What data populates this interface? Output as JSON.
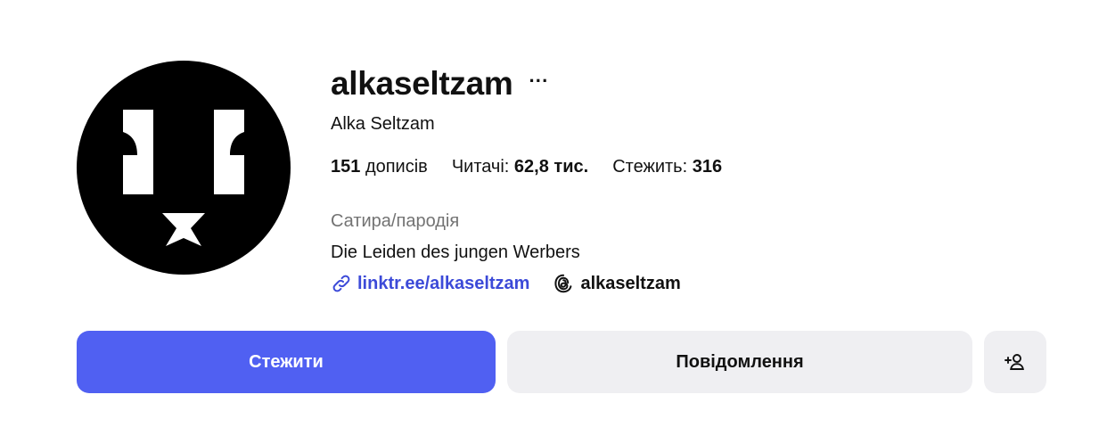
{
  "profile": {
    "username": "alkaseltzam",
    "more_label": "···",
    "full_name": "Alka Seltzam",
    "stats": {
      "posts_count": "151",
      "posts_label": "дописів",
      "followers_label": "Читачі:",
      "followers_count": "62,8 тис.",
      "following_label": "Стежить:",
      "following_count": "316"
    },
    "category": "Сатира/пародія",
    "bio": "Die Leiden des jungen Werbers",
    "link_text": "linktr.ee/alkaseltzam",
    "threads_handle": "alkaseltzam"
  },
  "actions": {
    "follow_label": "Стежити",
    "message_label": "Повідомлення",
    "add_user_icon": "person-add-icon"
  },
  "icons": {
    "link": "link-icon",
    "threads": "threads-icon",
    "avatar": "avatar-logo"
  },
  "colors": {
    "accent": "#5060f2",
    "link": "#3c4ad8",
    "secondary_button": "#efeff2",
    "muted_text": "#737373"
  }
}
